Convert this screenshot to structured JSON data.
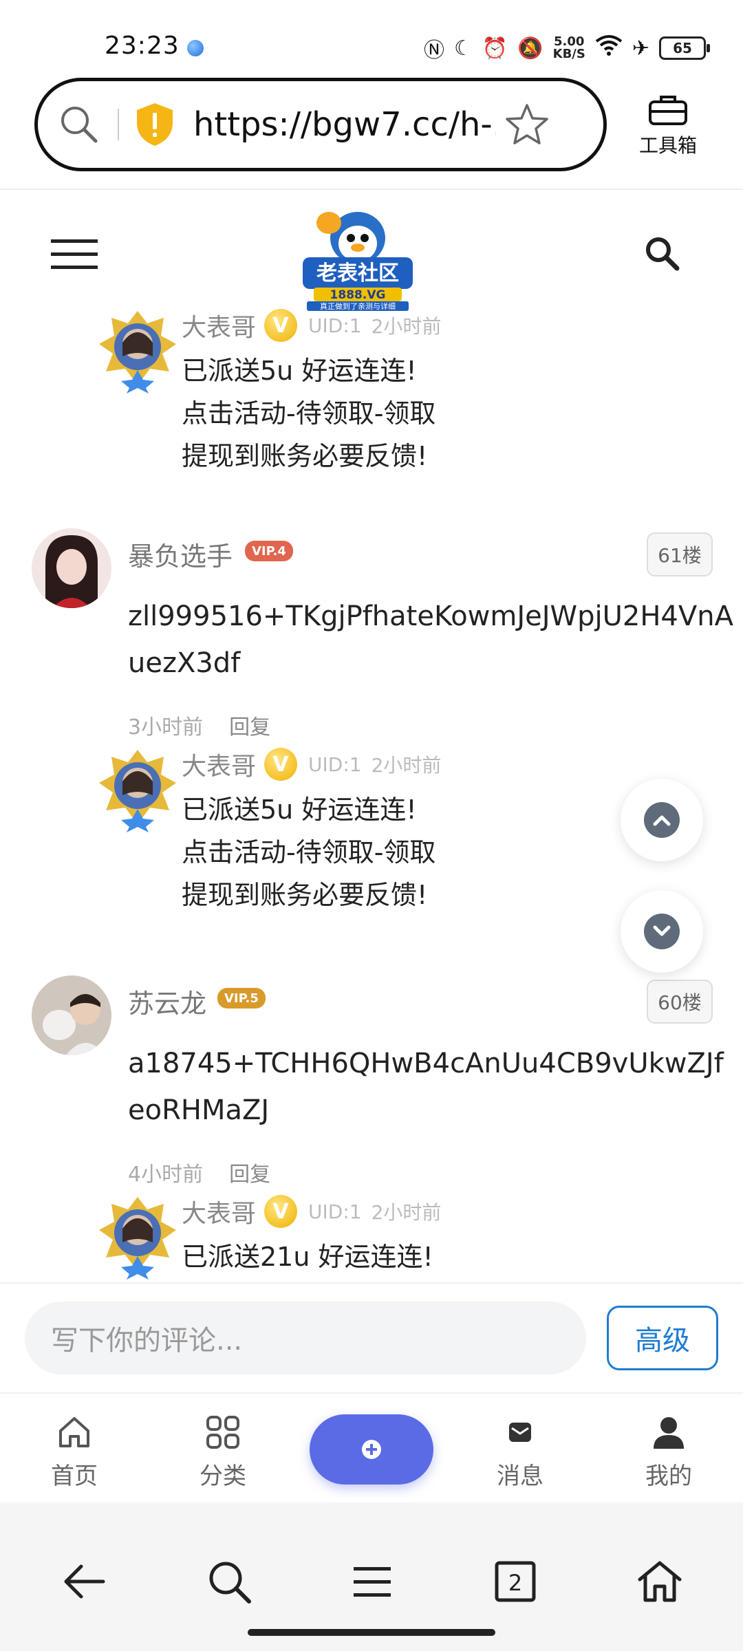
{
  "status_bar": {
    "time": "23:23",
    "network_speed_value": "5.00",
    "network_speed_unit": "KB/S",
    "battery": "65"
  },
  "browser": {
    "url": "https://bgw7.cc/h-...",
    "toolbox_label": "工具箱"
  },
  "site": {
    "logo_text": "老表社区",
    "logo_sub": "1888.VG",
    "logo_slogan": "真正做到了亲测与详细"
  },
  "thread": [
    {
      "type": "reply",
      "name": "大表哥",
      "badge": "V",
      "uid": "UID:1",
      "ago": "2小时前",
      "lines": [
        "已派送5u 好运连连!",
        "点击活动-待领取-领取",
        "提现到账务必要反馈!"
      ]
    },
    {
      "type": "post",
      "name": "暴负选手",
      "vip": "VIP.4",
      "floor": "61楼",
      "content": "zll999516+TKgjPfhateKowmJeJWpjU2H4VnAuezX3df",
      "time": "3小时前",
      "reply_label": "回复"
    },
    {
      "type": "reply",
      "name": "大表哥",
      "badge": "V",
      "uid": "UID:1",
      "ago": "2小时前",
      "lines": [
        "已派送5u 好运连连!",
        "点击活动-待领取-领取",
        "提现到账务必要反馈!"
      ]
    },
    {
      "type": "post",
      "name": "苏云龙",
      "vip": "VIP.5",
      "floor": "60楼",
      "content": "a18745+TCHH6QHwB4cAnUu4CB9vUkwZJfeoRHMaZJ",
      "time": "4小时前",
      "reply_label": "回复"
    },
    {
      "type": "reply",
      "name": "大表哥",
      "badge": "V",
      "uid": "UID:1",
      "ago": "2小时前",
      "lines": [
        "已派送21u 好运连连!"
      ]
    }
  ],
  "comment": {
    "placeholder": "写下你的评论...",
    "advanced_label": "高级"
  },
  "nav": {
    "home": "首页",
    "category": "分类",
    "messages": "消息",
    "mine": "我的"
  },
  "colors": {
    "accent": "#5b6be6",
    "link": "#1f7bd1",
    "vip4": "#e0664f",
    "vip5": "#d89a2a"
  }
}
